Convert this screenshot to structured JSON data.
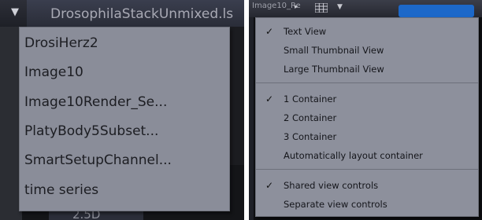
{
  "left": {
    "tab_label": "DrosophilaStackUnmixed.ls",
    "tab_arrow": "▼",
    "bottom_tab_label": "2.5D",
    "file_menu": [
      "DrosiHerz2",
      "Image10",
      "Image10Render_Se...",
      "PlatyBody5Subset...",
      "SmartSetupChannel...",
      "time series"
    ]
  },
  "right": {
    "tab_label": "Image10_Re",
    "tab_arrow": "▸",
    "dropdown_arrow": "▼",
    "view_menu": {
      "groups": [
        [
          {
            "label": "Text View",
            "checked": true
          },
          {
            "label": "Small Thumbnail View",
            "checked": false
          },
          {
            "label": "Large Thumbnail View",
            "checked": false
          }
        ],
        [
          {
            "label": "1 Container",
            "checked": true
          },
          {
            "label": "2 Container",
            "checked": false
          },
          {
            "label": "3 Container",
            "checked": false
          },
          {
            "label": "Automatically layout container",
            "checked": false
          }
        ],
        [
          {
            "label": "Shared view controls",
            "checked": true
          },
          {
            "label": "Separate view controls",
            "checked": false
          }
        ]
      ],
      "check_glyph": "✓"
    }
  },
  "colors": {
    "menu_bg": "#8d909c",
    "menu_text": "#15161b",
    "accent_blue": "#1c68c9",
    "titlebar_dark": "#1b1c20"
  }
}
